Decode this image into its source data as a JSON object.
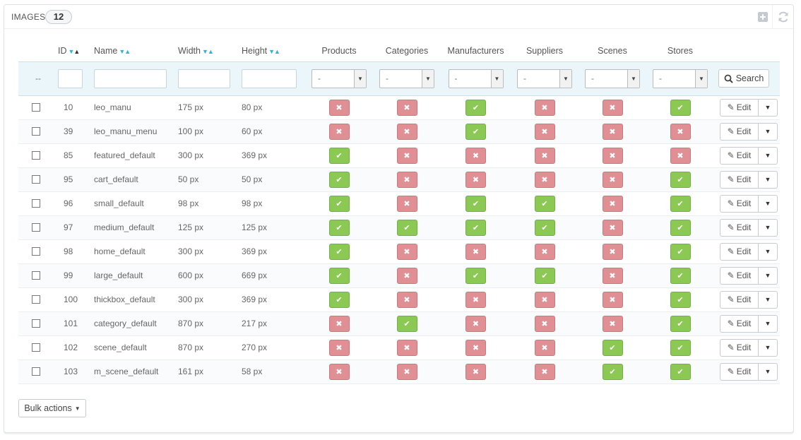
{
  "panel": {
    "title": "Images",
    "count": "12"
  },
  "columns": {
    "id": "ID",
    "name": "Name",
    "width": "Width",
    "height": "Height",
    "products": "Products",
    "categories": "Categories",
    "manufacturers": "Manufacturers",
    "suppliers": "Suppliers",
    "scenes": "Scenes",
    "stores": "Stores"
  },
  "filter": {
    "dash": "--",
    "select_value": "-",
    "search_label": "Search"
  },
  "row_actions": {
    "edit_label": "Edit"
  },
  "bulk_label": "Bulk actions",
  "colors": {
    "yes": "#8bc954",
    "no": "#e08f95",
    "accent": "#25b9d7"
  },
  "rows": [
    {
      "id": "10",
      "name": "leo_manu",
      "width": "175 px",
      "height": "80 px",
      "flags": [
        false,
        false,
        true,
        false,
        false,
        true
      ]
    },
    {
      "id": "39",
      "name": "leo_manu_menu",
      "width": "100 px",
      "height": "60 px",
      "flags": [
        false,
        false,
        true,
        false,
        false,
        false
      ]
    },
    {
      "id": "85",
      "name": "featured_default",
      "width": "300 px",
      "height": "369 px",
      "flags": [
        true,
        false,
        false,
        false,
        false,
        false
      ]
    },
    {
      "id": "95",
      "name": "cart_default",
      "width": "50 px",
      "height": "50 px",
      "flags": [
        true,
        false,
        false,
        false,
        false,
        true
      ]
    },
    {
      "id": "96",
      "name": "small_default",
      "width": "98 px",
      "height": "98 px",
      "flags": [
        true,
        false,
        true,
        true,
        false,
        true
      ]
    },
    {
      "id": "97",
      "name": "medium_default",
      "width": "125 px",
      "height": "125 px",
      "flags": [
        true,
        true,
        true,
        true,
        false,
        true
      ]
    },
    {
      "id": "98",
      "name": "home_default",
      "width": "300 px",
      "height": "369 px",
      "flags": [
        true,
        false,
        false,
        false,
        false,
        true
      ]
    },
    {
      "id": "99",
      "name": "large_default",
      "width": "600 px",
      "height": "669 px",
      "flags": [
        true,
        false,
        true,
        true,
        false,
        true
      ]
    },
    {
      "id": "100",
      "name": "thickbox_default",
      "width": "300 px",
      "height": "369 px",
      "flags": [
        true,
        false,
        false,
        false,
        false,
        true
      ]
    },
    {
      "id": "101",
      "name": "category_default",
      "width": "870 px",
      "height": "217 px",
      "flags": [
        false,
        true,
        false,
        false,
        false,
        true
      ]
    },
    {
      "id": "102",
      "name": "scene_default",
      "width": "870 px",
      "height": "270 px",
      "flags": [
        false,
        false,
        false,
        false,
        true,
        true
      ]
    },
    {
      "id": "103",
      "name": "m_scene_default",
      "width": "161 px",
      "height": "58 px",
      "flags": [
        false,
        false,
        false,
        false,
        true,
        true
      ]
    }
  ]
}
